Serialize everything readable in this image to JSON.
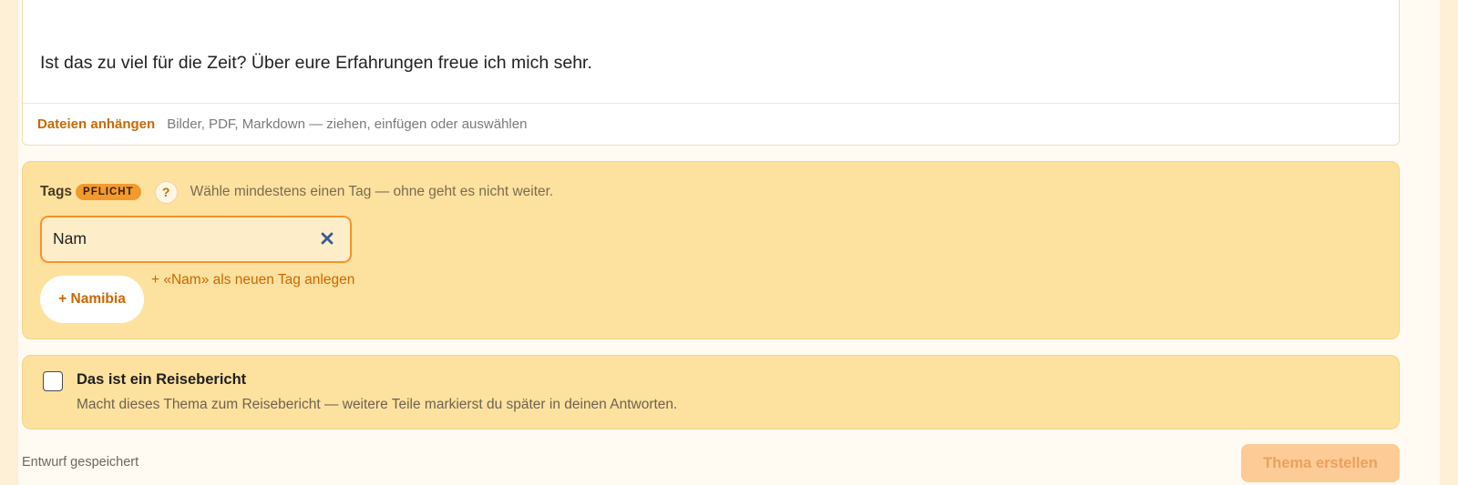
{
  "editor": {
    "body_text": "Ist das zu viel für die Zeit? Über eure Erfahrungen freue ich mich sehr.",
    "attach_label": "Dateien anhängen",
    "attach_hint": "Bilder, PDF, Markdown — ziehen, einfügen oder auswählen"
  },
  "tags": {
    "label": "Tags",
    "required_badge": "PFLICHT",
    "help_icon": "?",
    "hint": "Wähle mindestens einen Tag — ohne geht es nicht weiter.",
    "input_value": "Nam",
    "clear_icon": "close-icon",
    "suggestion": "+ Namibia",
    "create_new": "+ «Nam» als neuen Tag anlegen"
  },
  "report": {
    "checked": false,
    "title": "Das ist ein Reisebericht",
    "description": "Macht dieses Thema zum Reisebericht — weitere Teile markierst du später in deinen Antworten."
  },
  "footer": {
    "draft_status": "Entwurf gespeichert",
    "submit_label": "Thema erstellen"
  },
  "colors": {
    "accent": "#c86800",
    "panel_bg": "#fde29f",
    "badge_bg": "#f29a2e",
    "input_border": "#f5922b",
    "submit_disabled_bg": "#fdcb96"
  }
}
